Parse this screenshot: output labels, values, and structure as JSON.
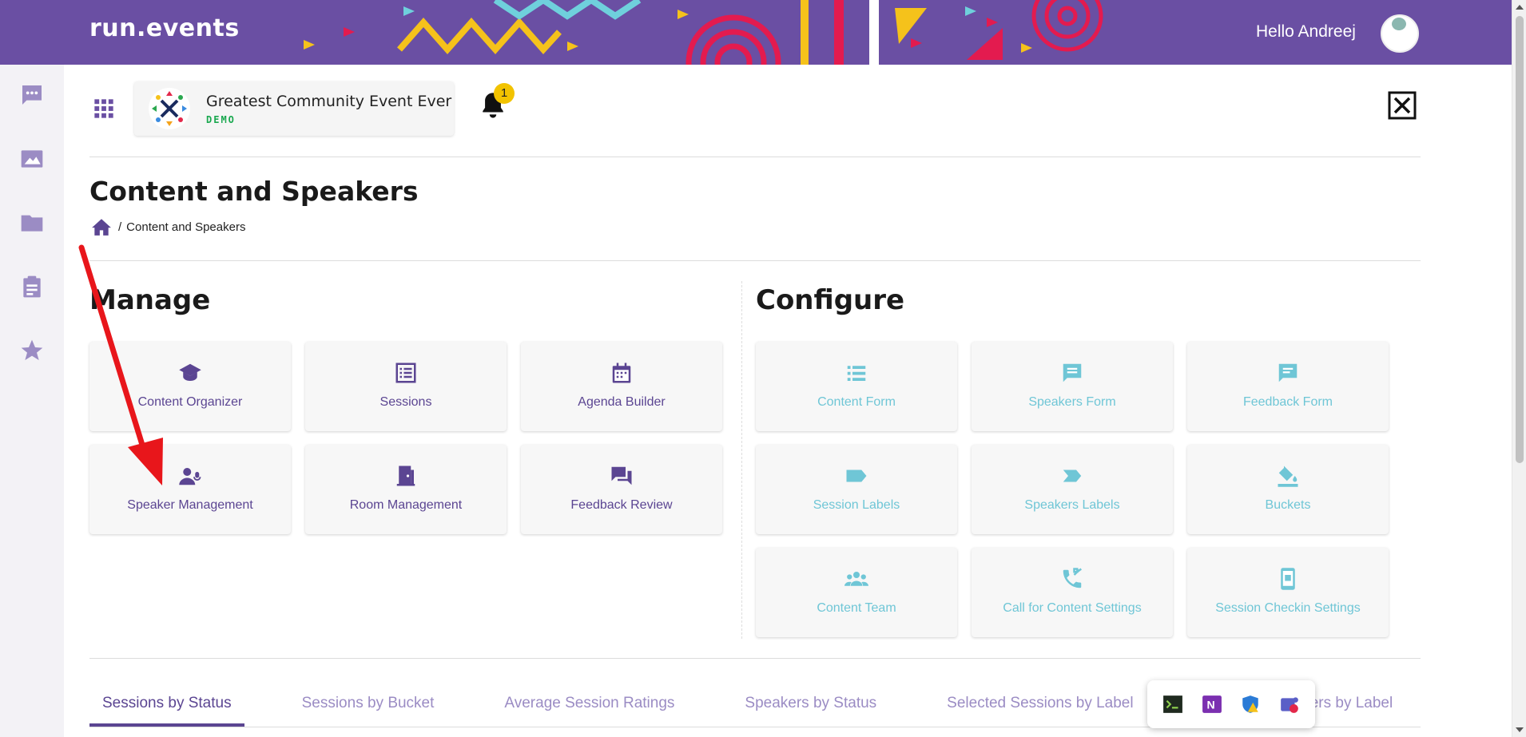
{
  "header": {
    "logo_text": "run.events",
    "greeting": "Hello Andreej"
  },
  "event": {
    "name": "Greatest Community Event Ever",
    "tag": "DEMO",
    "notification_count": "1"
  },
  "rail": {
    "items": [
      "chat-icon",
      "image-icon",
      "folder-icon",
      "clipboard-icon",
      "star-icon"
    ]
  },
  "page": {
    "title": "Content and Speakers",
    "breadcrumb_sep": "/",
    "breadcrumb_current": "Content and Speakers"
  },
  "manage": {
    "title": "Manage",
    "tiles": [
      {
        "label": "Content Organizer",
        "icon": "graduation-cap-icon"
      },
      {
        "label": "Sessions",
        "icon": "list-alt-icon"
      },
      {
        "label": "Agenda Builder",
        "icon": "calendar-icon"
      },
      {
        "label": "Speaker Management",
        "icon": "speaker-user-icon"
      },
      {
        "label": "Room Management",
        "icon": "door-icon"
      },
      {
        "label": "Feedback Review",
        "icon": "chat-bubbles-icon"
      }
    ]
  },
  "configure": {
    "title": "Configure",
    "tiles": [
      {
        "label": "Content Form",
        "icon": "list-icon"
      },
      {
        "label": "Speakers Form",
        "icon": "message-text-icon"
      },
      {
        "label": "Feedback Form",
        "icon": "feedback-icon"
      },
      {
        "label": "Session Labels",
        "icon": "label-icon"
      },
      {
        "label": "Speakers Labels",
        "icon": "label-arrow-icon"
      },
      {
        "label": "Buckets",
        "icon": "paint-bucket-icon"
      },
      {
        "label": "Content Team",
        "icon": "team-icon"
      },
      {
        "label": "Call for Content Settings",
        "icon": "phone-forward-icon"
      },
      {
        "label": "Session Checkin Settings",
        "icon": "mobile-checkin-icon"
      }
    ]
  },
  "tabs": [
    {
      "label": "Sessions by Status",
      "active": true
    },
    {
      "label": "Sessions by Bucket",
      "active": false
    },
    {
      "label": "Average Session Ratings",
      "active": false
    },
    {
      "label": "Speakers by Status",
      "active": false
    },
    {
      "label": "Selected Sessions by Label",
      "active": false
    },
    {
      "label": "Selected Speakers by Label",
      "active": false
    }
  ],
  "colors": {
    "brand_purple": "#6a4fa3",
    "manage_text": "#5b4592",
    "config_text": "#6fc6d6",
    "annotation_arrow": "#e8161b"
  }
}
